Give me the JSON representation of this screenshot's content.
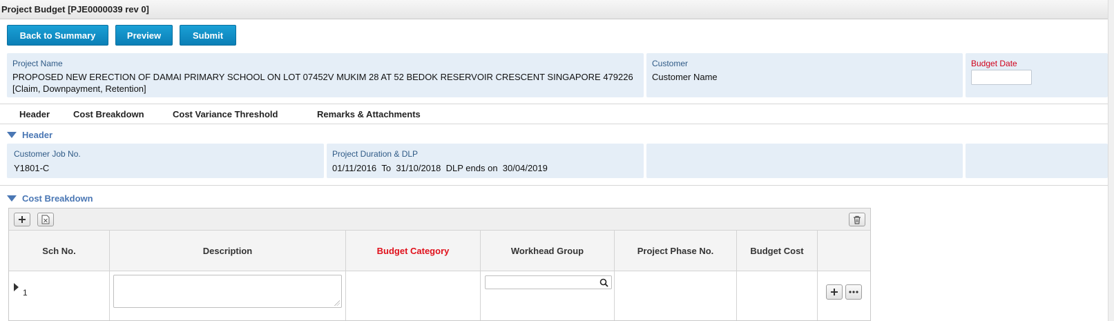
{
  "window": {
    "title": "Project Budget [PJE0000039 rev 0]"
  },
  "toolbar": {
    "back_label": "Back to Summary",
    "preview_label": "Preview",
    "submit_label": "Submit"
  },
  "project": {
    "name_label": "Project Name",
    "name_value_line1": "PROPOSED NEW ERECTION OF DAMAI PRIMARY SCHOOL ON LOT 07452V MUKIM 28 AT 52 BEDOK RESERVOIR CRESCENT SINGAPORE 479226",
    "name_value_line2": "[Claim, Downpayment, Retention]",
    "customer_label": "Customer",
    "customer_value": "Customer Name",
    "budget_date_label": "Budget Date",
    "budget_date_value": ""
  },
  "tabs": [
    {
      "label": "Header"
    },
    {
      "label": "Cost Breakdown"
    },
    {
      "label": "Cost Variance Threshold"
    },
    {
      "label": "Remarks & Attachments"
    }
  ],
  "header_section": {
    "title": "Header",
    "customer_job_label": "Customer Job No.",
    "customer_job_value": "Y1801-C",
    "duration_label": "Project Duration & DLP",
    "start_date": "01/11/2016",
    "to_text": "To",
    "end_date": "31/10/2018",
    "dlp_text": "DLP ends on",
    "dlp_date": "30/04/2019"
  },
  "cost_breakdown": {
    "title": "Cost Breakdown",
    "columns": [
      "Sch No.",
      "Description",
      "Budget Category",
      "Workhead Group",
      "Project Phase No.",
      "Budget Cost"
    ],
    "rows": [
      {
        "sch_no": "1",
        "description": "",
        "budget_category": "",
        "workhead_group": "",
        "project_phase_no": "",
        "budget_cost": ""
      }
    ]
  },
  "icons": {
    "add": "plus-icon",
    "excel": "excel-export-icon",
    "delete": "trash-icon",
    "search": "search-icon",
    "more": "ellipsis-icon",
    "collapse": "collapse-triangle-icon"
  },
  "colors": {
    "primary_button": "#0b7fb6",
    "required_label": "#e0101b",
    "section_title": "#4a77b4",
    "panel_bg": "#e5eef7"
  }
}
